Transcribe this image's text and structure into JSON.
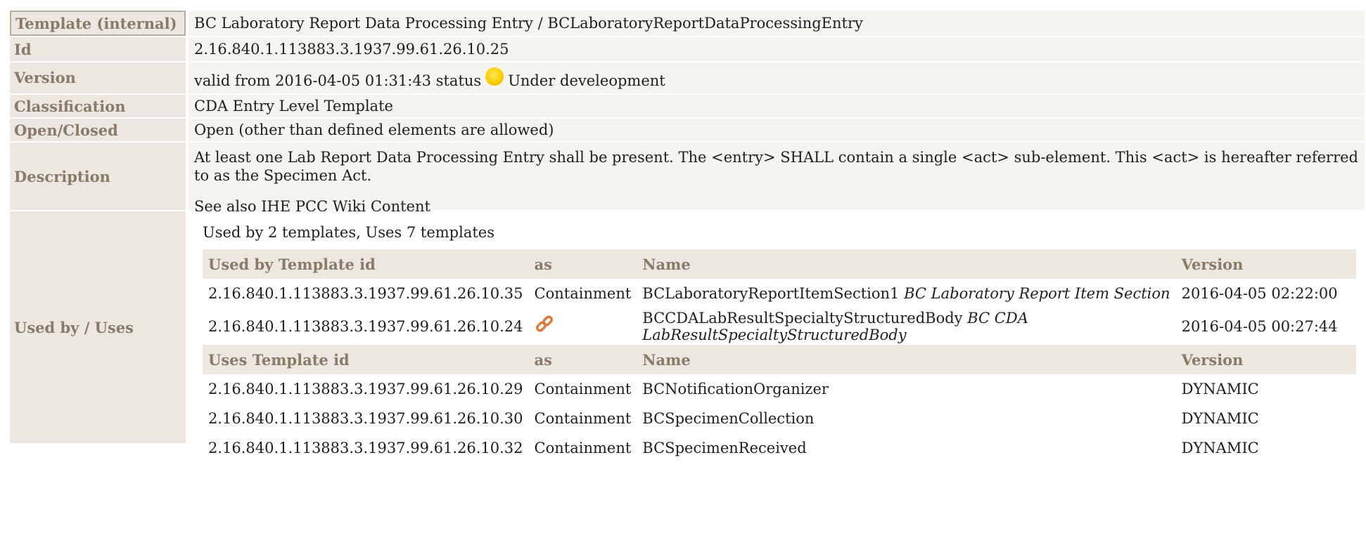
{
  "rows": {
    "template": {
      "label": "Template (internal)",
      "value": "BC Laboratory Report Data Processing Entry / BCLaboratoryReportDataProcessingEntry"
    },
    "id": {
      "label": "Id",
      "value": "2.16.840.1.113883.3.1937.99.61.26.10.25"
    },
    "version": {
      "label": "Version",
      "prefix": "valid from 2016-04-05 01:31:43 status",
      "status": "Under develeopment",
      "status_color": "#ffcc00"
    },
    "classification": {
      "label": "Classification",
      "value": "CDA Entry Level Template"
    },
    "open_closed": {
      "label": "Open/Closed",
      "value": "Open (other than defined elements are allowed)"
    },
    "description": {
      "label": "Description",
      "text1": "At least one Lab Report Data Processing Entry shall be present. The <entry> SHALL contain a single <act> sub-element. This <act> is hereafter referred to as the Specimen Act.",
      "text2": "See also IHE PCC Wiki Content"
    },
    "used_by": {
      "label": "Used by / Uses",
      "summary": "Used by 2 templates, Uses 7 templates"
    }
  },
  "used_by_table": {
    "headers": [
      "Used by Template id",
      "as",
      "Name",
      "Version"
    ],
    "rows": [
      {
        "id": "2.16.840.1.113883.3.1937.99.61.26.10.35",
        "as": "Containment",
        "name": "BCLaboratoryReportItemSection1",
        "display": "BC Laboratory Report Item Section",
        "version": "2016-04-05 02:22:00"
      },
      {
        "id": "2.16.840.1.113883.3.1937.99.61.26.10.24",
        "as": "link-icon",
        "name": "BCCDALabResultSpecialtyStructuredBody",
        "display": "BC CDA LabResultSpecialtyStructuredBody",
        "version": "2016-04-05 00:27:44"
      }
    ]
  },
  "uses_table": {
    "headers": [
      "Uses Template id",
      "as",
      "Name",
      "Version"
    ],
    "rows": [
      {
        "id": "2.16.840.1.113883.3.1937.99.61.26.10.29",
        "as": "Containment",
        "name": "BCNotificationOrganizer",
        "version": "DYNAMIC"
      },
      {
        "id": "2.16.840.1.113883.3.1937.99.61.26.10.30",
        "as": "Containment",
        "name": "BCSpecimenCollection",
        "version": "DYNAMIC"
      },
      {
        "id": "2.16.840.1.113883.3.1937.99.61.26.10.32",
        "as": "Containment",
        "name": "BCSpecimenReceived",
        "version": "DYNAMIC"
      }
    ]
  },
  "colors": {
    "label_bg": "#ece8e1",
    "label_text": "#8a7a68",
    "value_bg": "#f6f4f0",
    "link_icon": "#e07a3a"
  }
}
